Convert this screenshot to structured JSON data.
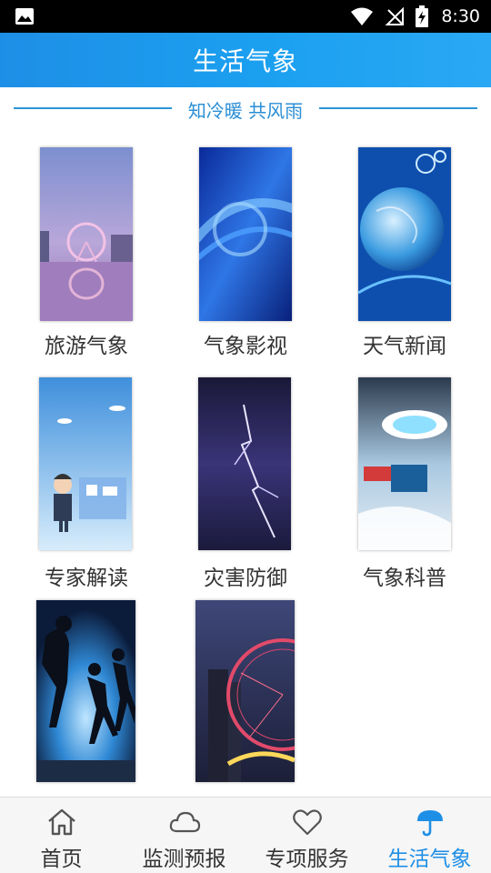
{
  "status_bar": {
    "time": "8:30",
    "icons": [
      "gallery-icon",
      "wifi-icon",
      "signal-off-icon",
      "battery-charging-icon"
    ]
  },
  "header": {
    "title": "生活气象"
  },
  "slogan": "知冷暖 共风雨",
  "tiles": [
    {
      "label": "旅游气象",
      "image": "ferris-wheel-dusk"
    },
    {
      "label": "气象影视",
      "image": "blue-abstract-swirl"
    },
    {
      "label": "天气新闻",
      "image": "glass-globe"
    },
    {
      "label": "专家解读",
      "image": "expert-cartoon"
    },
    {
      "label": "灾害防御",
      "image": "lightning-storm"
    },
    {
      "label": "气象科普",
      "image": "futuristic-hall"
    },
    {
      "label": "",
      "image": "runners-silhouette"
    },
    {
      "label": "",
      "image": "ferris-wheel-night"
    }
  ],
  "bottom_nav": {
    "items": [
      {
        "label": "首页",
        "icon": "home-icon"
      },
      {
        "label": "监测预报",
        "icon": "cloud-icon"
      },
      {
        "label": "专项服务",
        "icon": "heart-icon"
      },
      {
        "label": "生活气象",
        "icon": "umbrella-icon",
        "active": true
      }
    ]
  },
  "colors": {
    "accent": "#1e8fe6",
    "header_start": "#1e8fe6",
    "header_end": "#2aa8f4",
    "status_bar": "#000000"
  }
}
